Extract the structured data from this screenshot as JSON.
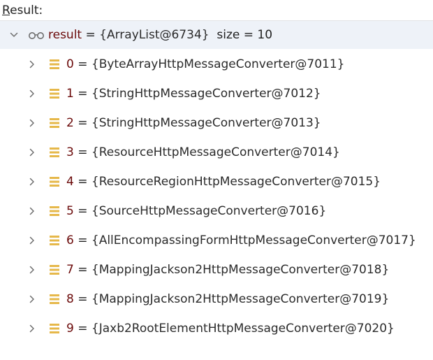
{
  "panel": {
    "label_mnemonic": "R",
    "label_rest": "esult:"
  },
  "root": {
    "name": "result",
    "eq": "=",
    "value": "{ArrayList@6734}",
    "size_text": "size = 10",
    "expanded": true,
    "icon": "watch-glasses-icon"
  },
  "items": [
    {
      "index": "0",
      "eq": "=",
      "value": "{ByteArrayHttpMessageConverter@7011}"
    },
    {
      "index": "1",
      "eq": "=",
      "value": "{StringHttpMessageConverter@7012}"
    },
    {
      "index": "2",
      "eq": "=",
      "value": "{StringHttpMessageConverter@7013}"
    },
    {
      "index": "3",
      "eq": "=",
      "value": "{ResourceHttpMessageConverter@7014}"
    },
    {
      "index": "4",
      "eq": "=",
      "value": "{ResourceRegionHttpMessageConverter@7015}"
    },
    {
      "index": "5",
      "eq": "=",
      "value": "{SourceHttpMessageConverter@7016}"
    },
    {
      "index": "6",
      "eq": "=",
      "value": "{AllEncompassingFormHttpMessageConverter@7017}"
    },
    {
      "index": "7",
      "eq": "=",
      "value": "{MappingJackson2HttpMessageConverter@7018}"
    },
    {
      "index": "8",
      "eq": "=",
      "value": "{MappingJackson2HttpMessageConverter@7019}"
    },
    {
      "index": "9",
      "eq": "=",
      "value": "{Jaxb2RootElementHttpMessageConverter@7020}"
    }
  ],
  "colors": {
    "selected_row": "#eef2f8",
    "field_icon": "#e6b84a",
    "name": "#6b0a0a"
  }
}
